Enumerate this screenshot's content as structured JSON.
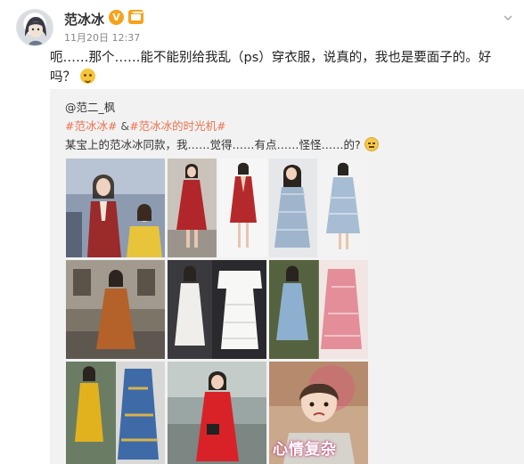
{
  "post": {
    "username": "范冰冰",
    "verified_badge": "V",
    "timestamp": "11月20日 12:37",
    "text": "呃……那个……能不能别给我乱（ps）穿衣服，说真的，我也是要面子的。好吗？",
    "text_emoji": "laughing-tears-icon"
  },
  "repost": {
    "author": "@范二_枫",
    "hashtag_1": "#范冰冰#",
    "hashtag_separator": " &",
    "hashtag_2": "#范冰冰的时光机#",
    "text": "某宝上的范冰冰同款，我……觉得……有点……怪怪……的?",
    "text_emoji": "doge-icon"
  },
  "photos": {
    "last_caption": "心情复杂"
  },
  "colors": {
    "hashtag": "#eb7350",
    "verified": "#f7a21b",
    "repost_bg": "#f2f2f2"
  }
}
